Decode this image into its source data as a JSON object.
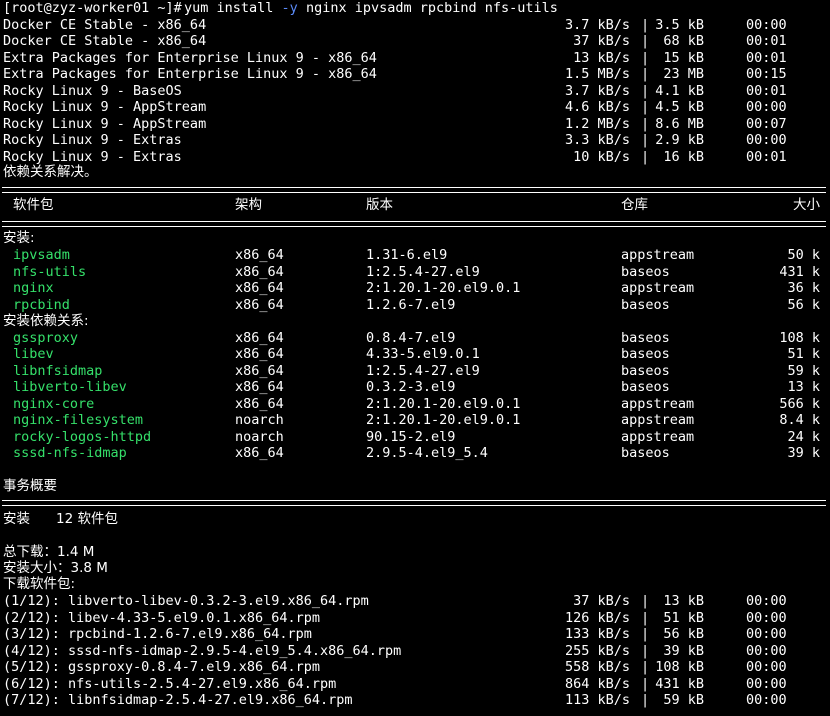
{
  "prompt": "[root@zyz-worker01 ~]#",
  "command": {
    "prefix": "yum install ",
    "option": "-y",
    "args": " nginx ipvsadm rpcbind nfs-utils"
  },
  "repo_sync": [
    {
      "name": "Docker CE Stable - x86_64",
      "speed": "3.7 kB/s",
      "size": "3.5 kB",
      "time": "00:00"
    },
    {
      "name": "Docker CE Stable - x86_64",
      "speed": "37 kB/s",
      "size": "68 kB",
      "time": "00:01"
    },
    {
      "name": "Extra Packages for Enterprise Linux 9 - x86_64",
      "speed": "13 kB/s",
      "size": "15 kB",
      "time": "00:01"
    },
    {
      "name": "Extra Packages for Enterprise Linux 9 - x86_64",
      "speed": "1.5 MB/s",
      "size": "23 MB",
      "time": "00:15"
    },
    {
      "name": "Rocky Linux 9 - BaseOS",
      "speed": "3.7 kB/s",
      "size": "4.1 kB",
      "time": "00:01"
    },
    {
      "name": "Rocky Linux 9 - AppStream",
      "speed": "4.6 kB/s",
      "size": "4.5 kB",
      "time": "00:00"
    },
    {
      "name": "Rocky Linux 9 - AppStream",
      "speed": "1.2 MB/s",
      "size": "8.6 MB",
      "time": "00:07"
    },
    {
      "name": "Rocky Linux 9 - Extras",
      "speed": "3.3 kB/s",
      "size": "2.9 kB",
      "time": "00:00"
    },
    {
      "name": "Rocky Linux 9 - Extras",
      "speed": "10 kB/s",
      "size": "16 kB",
      "time": "00:01"
    }
  ],
  "deps_resolved": "依赖关系解决。",
  "table": {
    "headers": {
      "package": "软件包",
      "arch": "架构",
      "version": "版本",
      "repo": "仓库",
      "size": "大小"
    },
    "install_heading": "安装:",
    "install": [
      {
        "package": "ipvsadm",
        "arch": "x86_64",
        "version": "1.31-6.el9",
        "repo": "appstream",
        "size": "50 k"
      },
      {
        "package": "nfs-utils",
        "arch": "x86_64",
        "version": "1:2.5.4-27.el9",
        "repo": "baseos",
        "size": "431 k"
      },
      {
        "package": "nginx",
        "arch": "x86_64",
        "version": "2:1.20.1-20.el9.0.1",
        "repo": "appstream",
        "size": "36 k"
      },
      {
        "package": "rpcbind",
        "arch": "x86_64",
        "version": "1.2.6-7.el9",
        "repo": "baseos",
        "size": "56 k"
      }
    ],
    "deps_heading": "安装依赖关系:",
    "deps": [
      {
        "package": "gssproxy",
        "arch": "x86_64",
        "version": "0.8.4-7.el9",
        "repo": "baseos",
        "size": "108 k"
      },
      {
        "package": "libev",
        "arch": "x86_64",
        "version": "4.33-5.el9.0.1",
        "repo": "baseos",
        "size": "51 k"
      },
      {
        "package": "libnfsidmap",
        "arch": "x86_64",
        "version": "1:2.5.4-27.el9",
        "repo": "baseos",
        "size": "59 k"
      },
      {
        "package": "libverto-libev",
        "arch": "x86_64",
        "version": "0.3.2-3.el9",
        "repo": "baseos",
        "size": "13 k"
      },
      {
        "package": "nginx-core",
        "arch": "x86_64",
        "version": "2:1.20.1-20.el9.0.1",
        "repo": "appstream",
        "size": "566 k"
      },
      {
        "package": "nginx-filesystem",
        "arch": "noarch",
        "version": "2:1.20.1-20.el9.0.1",
        "repo": "appstream",
        "size": "8.4 k"
      },
      {
        "package": "rocky-logos-httpd",
        "arch": "noarch",
        "version": "90.15-2.el9",
        "repo": "appstream",
        "size": "24 k"
      },
      {
        "package": "sssd-nfs-idmap",
        "arch": "x86_64",
        "version": "2.9.5-4.el9_5.4",
        "repo": "baseos",
        "size": "39 k"
      }
    ]
  },
  "summary": {
    "heading": "事务概要",
    "install_label": "安装",
    "install_count": "12 软件包",
    "total_download": "总下载：1.4 M",
    "installed_size": "安装大小：3.8 M",
    "downloading": "下载软件包:"
  },
  "downloads": [
    {
      "name": "(1/12): libverto-libev-0.3.2-3.el9.x86_64.rpm",
      "speed": "37 kB/s",
      "size": "13 kB",
      "time": "00:00"
    },
    {
      "name": "(2/12): libev-4.33-5.el9.0.1.x86_64.rpm",
      "speed": "126 kB/s",
      "size": "51 kB",
      "time": "00:00"
    },
    {
      "name": "(3/12): rpcbind-1.2.6-7.el9.x86_64.rpm",
      "speed": "133 kB/s",
      "size": "56 kB",
      "time": "00:00"
    },
    {
      "name": "(4/12): sssd-nfs-idmap-2.9.5-4.el9_5.4.x86_64.rpm",
      "speed": "255 kB/s",
      "size": "39 kB",
      "time": "00:00"
    },
    {
      "name": "(5/12): gssproxy-0.8.4-7.el9.x86_64.rpm",
      "speed": "558 kB/s",
      "size": "108 kB",
      "time": "00:00"
    },
    {
      "name": "(6/12): nfs-utils-2.5.4-27.el9.x86_64.rpm",
      "speed": "864 kB/s",
      "size": "431 kB",
      "time": "00:00"
    },
    {
      "name": "(7/12): libnfsidmap-2.5.4-27.el9.x86_64.rpm",
      "speed": "113 kB/s",
      "size": "59 kB",
      "time": "00:00"
    }
  ],
  "separator_char": "|"
}
